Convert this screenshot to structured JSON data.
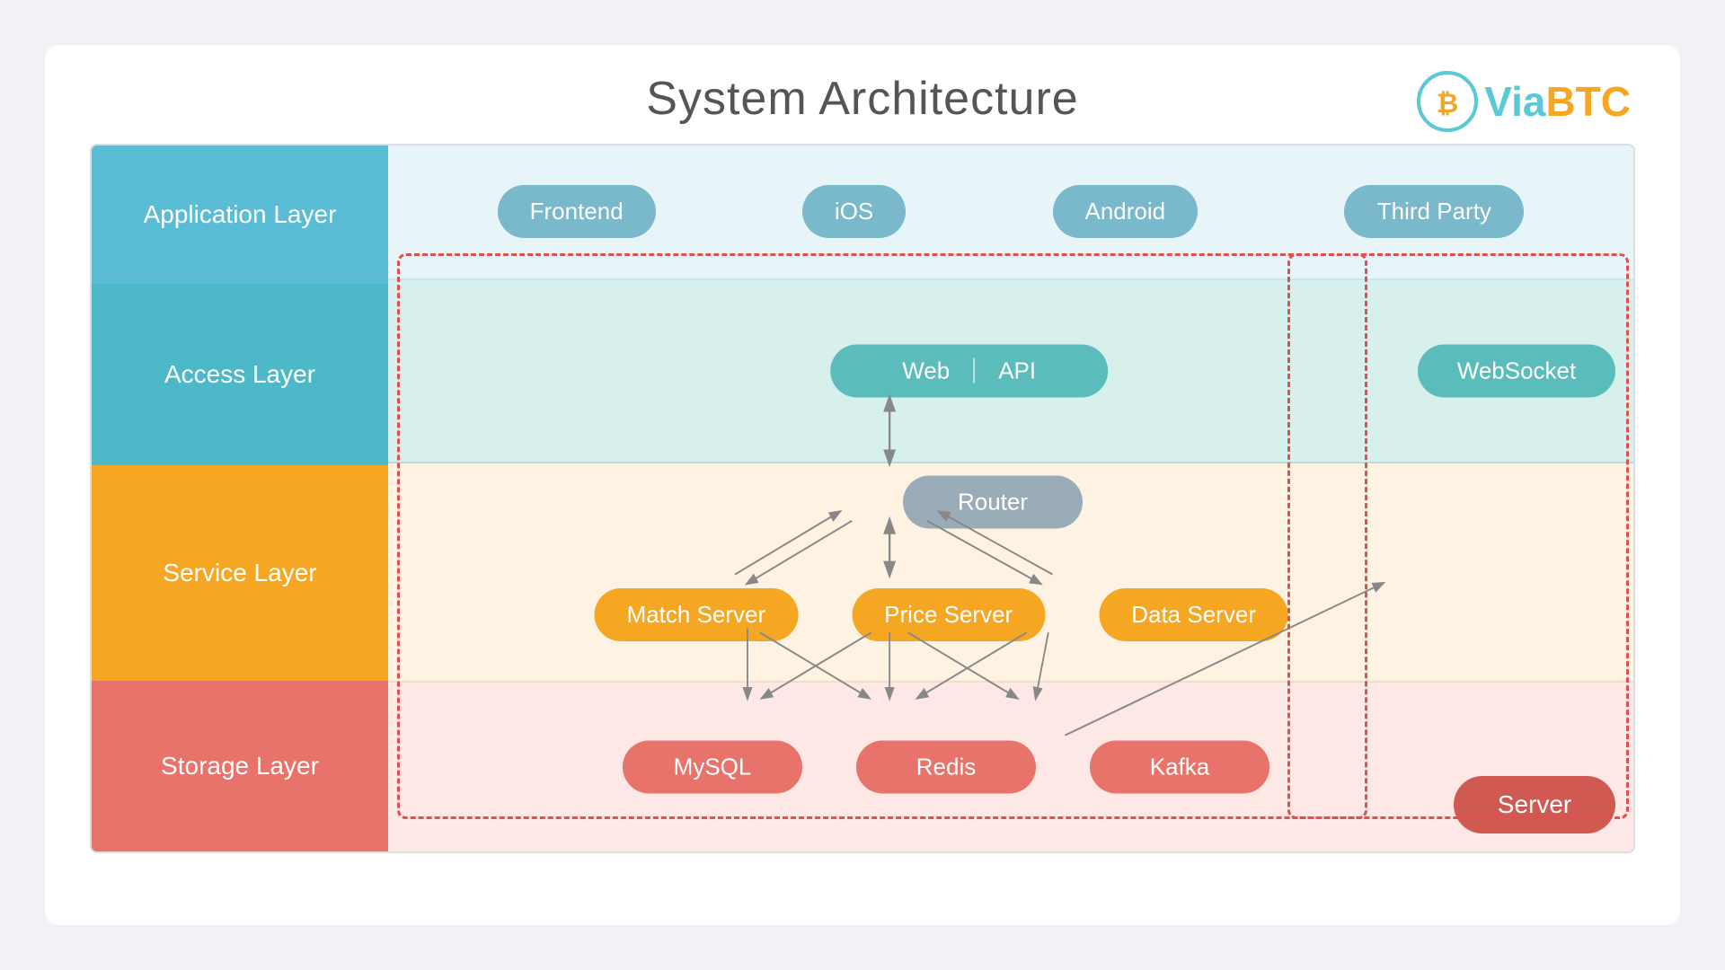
{
  "title": "System Architecture",
  "logo": {
    "via": "Via",
    "btc": "BTC"
  },
  "labels": {
    "application": "Application Layer",
    "access": "Access Layer",
    "service": "Service Layer",
    "storage": "Storage Layer"
  },
  "app_layer": {
    "items": [
      "Frontend",
      "iOS",
      "Android",
      "Third Party"
    ]
  },
  "access_layer": {
    "web": "Web",
    "api": "API",
    "websocket": "WebSocket"
  },
  "service_layer": {
    "router": "Router",
    "items": [
      "Match Server",
      "Price Server",
      "Data Server"
    ]
  },
  "storage_layer": {
    "items": [
      "MySQL",
      "Redis",
      "Kafka"
    ]
  },
  "server": "Server"
}
